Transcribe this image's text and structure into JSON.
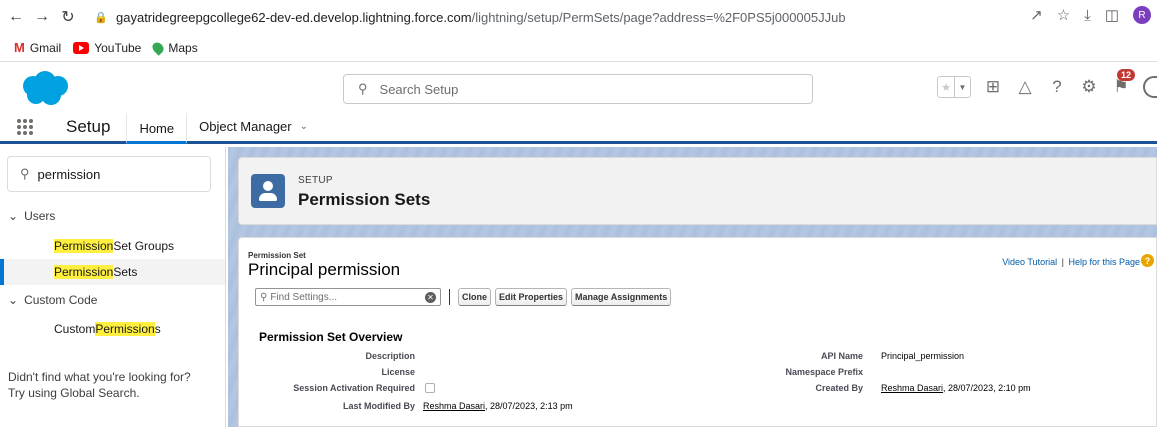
{
  "browser": {
    "back_icon": "back-arrow-icon",
    "forward_icon": "forward-arrow-icon",
    "reload_icon": "reload-icon",
    "url_host": "gayatridegreepgcollege62-dev-ed.develop.lightning.force.com",
    "url_path": "/lightning/setup/PermSets/page?address=%2F0PS5j000005JJub",
    "profile_initial": "R"
  },
  "bookmarks": [
    {
      "label": "Gmail",
      "icon": "gmail-icon"
    },
    {
      "label": "YouTube",
      "icon": "youtube-icon"
    },
    {
      "label": "Maps",
      "icon": "maps-icon"
    }
  ],
  "header": {
    "search_placeholder": "Search Setup",
    "notification_count": "12"
  },
  "context_bar": {
    "app_name": "Setup",
    "tabs": [
      {
        "label": "Home"
      },
      {
        "label": "Object Manager"
      }
    ]
  },
  "sidebar": {
    "quickfind_value": "permission",
    "groups": [
      {
        "label": "Users"
      },
      {
        "label": "Custom Code"
      }
    ],
    "items": [
      {
        "label_hl": "Permission",
        "label_rest": " Set Groups"
      },
      {
        "label_hl": "Permission",
        "label_rest": " Sets"
      },
      {
        "label_pre": "Custom ",
        "label_hl": "Permission",
        "label_rest": "s"
      }
    ],
    "not_found_line1": "Didn't find what you're looking for?",
    "not_found_line2": "Try using Global Search."
  },
  "page_header": {
    "eyebrow": "SETUP",
    "title": "Permission Sets"
  },
  "detail": {
    "eyebrow": "Permission Set",
    "name": "Principal permission",
    "video_tutorial": "Video Tutorial",
    "separator": "|",
    "help_link": "Help for this Page",
    "find_placeholder": "Find Settings...",
    "buttons": {
      "clone": "Clone",
      "edit_properties": "Edit Properties",
      "manage_assignments": "Manage Assignments"
    },
    "overview_title": "Permission Set Overview",
    "fields": {
      "description_label": "Description",
      "license_label": "License",
      "session_label": "Session Activation Required",
      "last_modified_label": "Last Modified By",
      "last_modified_user": "Reshma Dasari",
      "last_modified_date": ", 28/07/2023, 2:13 pm",
      "api_name_label": "API Name",
      "api_name_value": "Principal_permission",
      "namespace_label": "Namespace Prefix",
      "created_by_label": "Created By",
      "created_by_user": "Reshma Dasari",
      "created_by_date": ", 28/07/2023, 2:10 pm"
    }
  },
  "colors": {
    "brand_blue": "#0176d3",
    "highlight": "#fff03f",
    "badge_red": "#c23934"
  }
}
